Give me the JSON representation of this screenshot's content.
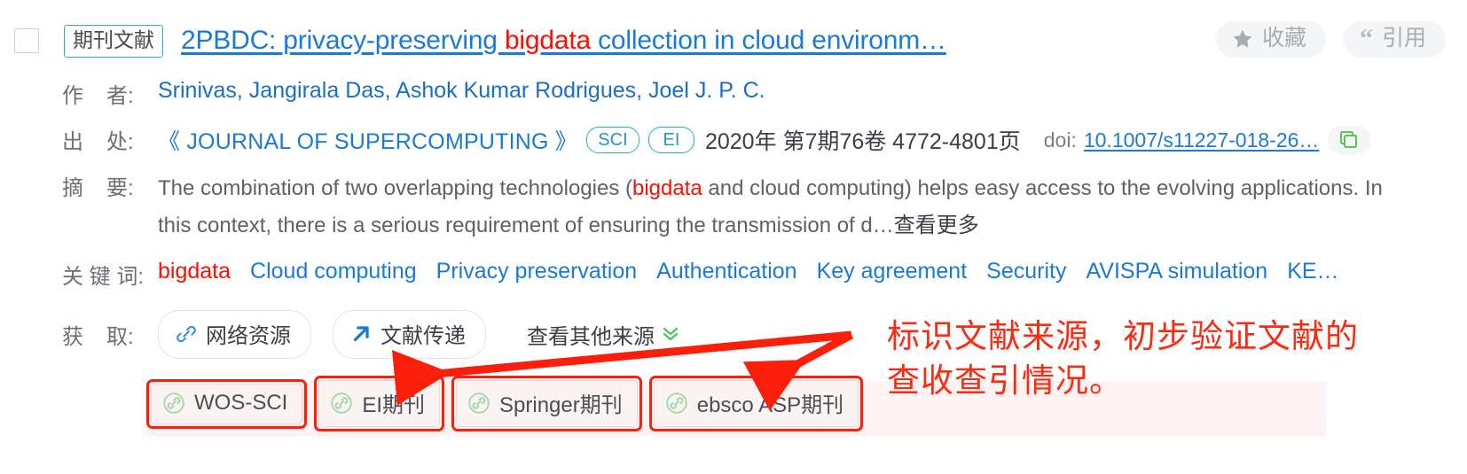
{
  "record": {
    "doctype_label": "期刊文献",
    "title_prefix": "2PBDC: privacy-preserving ",
    "title_highlight": "bigdata",
    "title_suffix": " collection in cloud environm…",
    "actions": {
      "favorite_label": "收藏",
      "cite_label": "引用",
      "favorite_icon": "star-icon",
      "cite_icon": "quote-icon"
    },
    "authors": {
      "label_a": "作",
      "label_b": "者:",
      "value": "Srinivas, Jangirala Das, Ashok Kumar Rodrigues, Joel J. P. C."
    },
    "source": {
      "label_a": "出",
      "label_b": "处:",
      "journal": "《 JOURNAL OF SUPERCOMPUTING 》",
      "badges": [
        "SCI",
        "EI"
      ],
      "pubinfo": "2020年 第7期76卷 4772-4801页",
      "doi_label": "doi:",
      "doi_value": "10.1007/s11227-018-26…",
      "copy_icon": "copy-icon"
    },
    "abstract": {
      "label_a": "摘",
      "label_b": "要:",
      "part1": "The combination of two overlapping technologies (",
      "highlight": "bigdata",
      "part2": " and cloud computing) helps easy access to the evolving applications. In this context, there is a serious requirement of ensuring the transmission of d…",
      "more_label": "查看更多"
    },
    "keywords": {
      "label": "关 键 词:",
      "items": [
        {
          "text": "bigdata",
          "highlighted": true
        },
        {
          "text": "Cloud computing",
          "highlighted": false
        },
        {
          "text": "Privacy preservation",
          "highlighted": false
        },
        {
          "text": "Authentication",
          "highlighted": false
        },
        {
          "text": "Key agreement",
          "highlighted": false
        },
        {
          "text": "Security",
          "highlighted": false
        },
        {
          "text": "AVISPA simulation",
          "highlighted": false
        },
        {
          "text": "KE…",
          "highlighted": false
        }
      ]
    },
    "access": {
      "label_a": "获",
      "label_b": "取:",
      "buttons": [
        {
          "label": "网络资源",
          "icon": "link-icon"
        },
        {
          "label": "文献传递",
          "icon": "arrow-up-right-icon"
        }
      ],
      "other_sources_label": "查看其他来源",
      "other_sources_icon": "double-chevron-down-icon"
    },
    "source_chips": [
      {
        "label": "WOS-SCI",
        "icon": "link-circle-icon"
      },
      {
        "label": "EI期刊",
        "icon": "link-circle-icon"
      },
      {
        "label": "Springer期刊",
        "icon": "link-circle-icon"
      },
      {
        "label": "ebsco ASP期刊",
        "icon": "link-circle-icon"
      }
    ],
    "annotation": {
      "line1": "标识文献来源，初步验证文献的",
      "line2": "查收查引情况。",
      "color": "#fb2a11"
    },
    "colors": {
      "link_blue": "#1a7ad4",
      "highlight_red": "#fb0f00",
      "badge_teal": "#2bb3ad",
      "annotation_red": "#fb2a11",
      "chip_outline_red": "#fb1e0a",
      "green_icon": "#54c06a"
    }
  }
}
